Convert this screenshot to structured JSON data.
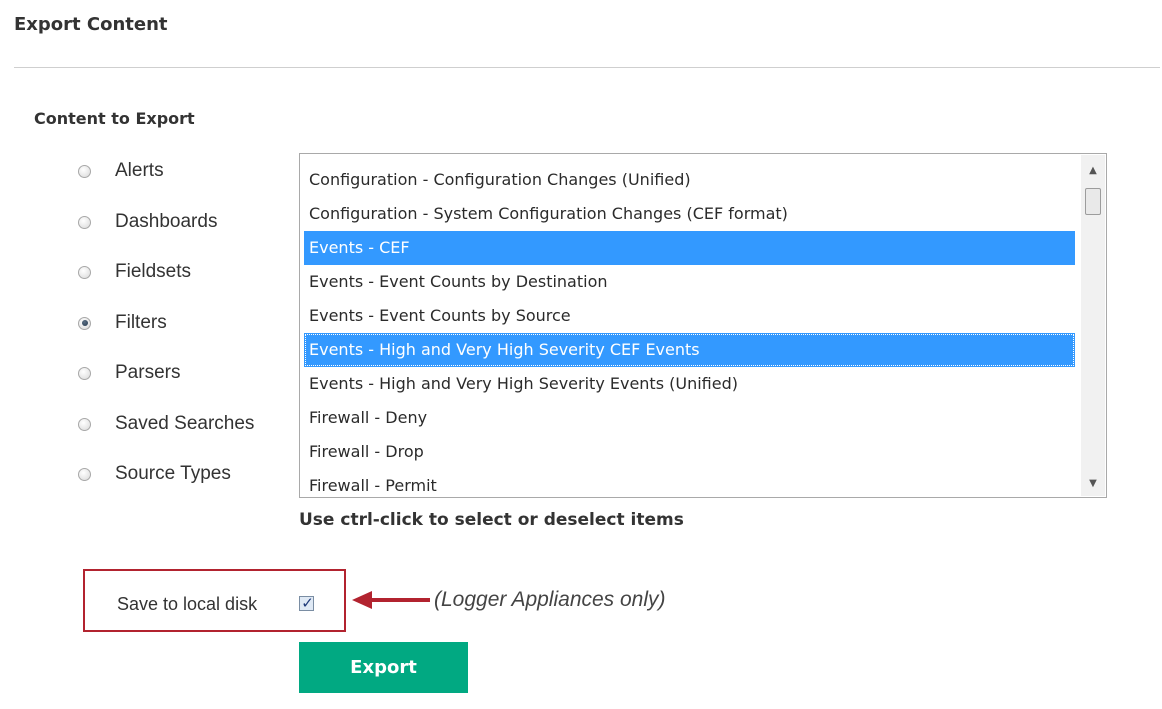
{
  "page": {
    "title": "Export Content"
  },
  "content_section": {
    "heading": "Content to Export",
    "radio_options": [
      {
        "label": "Alerts",
        "checked": false
      },
      {
        "label": "Dashboards",
        "checked": false
      },
      {
        "label": "Fieldsets",
        "checked": false
      },
      {
        "label": "Filters",
        "checked": true
      },
      {
        "label": "Parsers",
        "checked": false
      },
      {
        "label": "Saved Searches",
        "checked": false
      },
      {
        "label": "Source Types",
        "checked": false
      }
    ]
  },
  "list": {
    "items": [
      {
        "label": "Configuration - Configuration Changes (Unified)",
        "selected": false
      },
      {
        "label": "Configuration - System Configuration Changes (CEF format)",
        "selected": false
      },
      {
        "label": "Events - CEF",
        "selected": true
      },
      {
        "label": "Events - Event Counts by Destination",
        "selected": false
      },
      {
        "label": "Events - Event Counts by Source",
        "selected": false
      },
      {
        "label": "Events - High and Very High Severity CEF Events",
        "selected": true
      },
      {
        "label": "Events - High and Very High Severity Events (Unified)",
        "selected": false
      },
      {
        "label": "Firewall - Deny",
        "selected": false
      },
      {
        "label": "Firewall - Drop",
        "selected": false
      },
      {
        "label": "Firewall - Permit",
        "selected": false
      }
    ],
    "hint": "Use ctrl-click to select or deselect items",
    "selection_color": "#3399ff"
  },
  "save": {
    "label": "Save to local disk",
    "checked": true,
    "annotation": "(Logger Appliances only)",
    "highlight_color": "#b2232f"
  },
  "export_button": {
    "label": "Export",
    "color": "#01a982"
  }
}
